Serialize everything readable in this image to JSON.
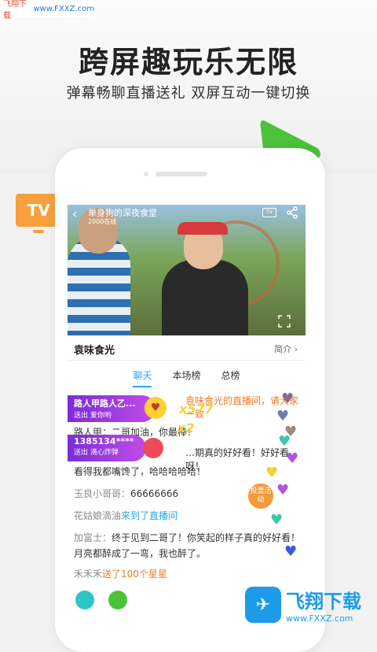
{
  "watermark": {
    "name": "飞翔下载",
    "url": "www.FXXZ.com"
  },
  "headline": "跨屏趣玩乐无限",
  "subline": "弹幕畅聊直播送礼  双屏互动一键切换",
  "tv_badge": "TV",
  "video": {
    "title": "单身狗的深夜食堂",
    "viewers": "2000在线",
    "tv_icon_text": "TV"
  },
  "room": {
    "name": "袁味食光",
    "intro": "简介"
  },
  "tabs": [
    {
      "label": "聊天",
      "active": true
    },
    {
      "label": "本场榜",
      "active": false
    },
    {
      "label": "总榜",
      "active": false
    }
  ],
  "chat": {
    "system_notice": "袁味食光的直播间，请大家一致",
    "line2": "路人甲：二哥加油，你最棒！",
    "line3": "…期真的好好看！好好看呀！",
    "line4": "看得我都嘴馋了，哈哈哈哈哈！",
    "line5_name": "玉良小哥哥：",
    "line5_text": "66666666",
    "line6_name": "花姑娘滴油",
    "line6_text": "来到了直播间",
    "line7_name": "加富士：",
    "line7_text": "终于见到二哥了！你笑起的样子真的好好看！",
    "line8": "月亮都醉成了一弯，我也醉了。",
    "line9_name": "禾禾禾",
    "line9_text": "送了100个星星"
  },
  "gifts": [
    {
      "user": "路人甲路人乙...",
      "action": "送出 爱你哟",
      "combo": "x577"
    },
    {
      "user": "1385134****",
      "action": "送出 滴心炸弹",
      "combo": "x2"
    }
  ],
  "vote_button": "投票活动",
  "logo": {
    "name": "飞翔下载",
    "url": "www.FXXZ.com"
  },
  "colors": {
    "accent": "#2aa6e8",
    "orange": "#f07c24",
    "green": "#4cc13a",
    "gift_purple": "#9a35df"
  }
}
